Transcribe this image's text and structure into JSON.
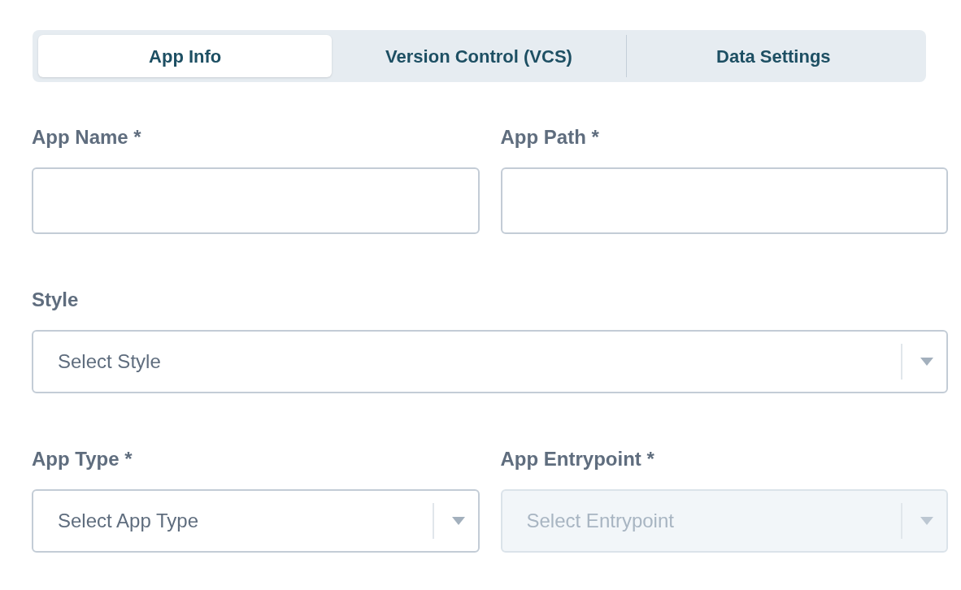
{
  "tabs": [
    {
      "label": "App Info",
      "selected": true
    },
    {
      "label": "Version Control (VCS)",
      "selected": false
    },
    {
      "label": "Data Settings",
      "selected": false
    }
  ],
  "rows": [
    [
      {
        "kind": "text",
        "label": "App Name *",
        "disabled": false
      },
      {
        "kind": "text",
        "label": "App Path *",
        "disabled": false
      }
    ],
    [
      {
        "kind": "select",
        "label": "Style",
        "placeholder": "Select Style",
        "disabled": false
      }
    ],
    [
      {
        "kind": "select",
        "label": "App Type *",
        "placeholder": "Select App Type",
        "disabled": false
      },
      {
        "kind": "select",
        "label": "App Entrypoint *",
        "placeholder": "Select Entrypoint",
        "disabled": true
      }
    ]
  ]
}
